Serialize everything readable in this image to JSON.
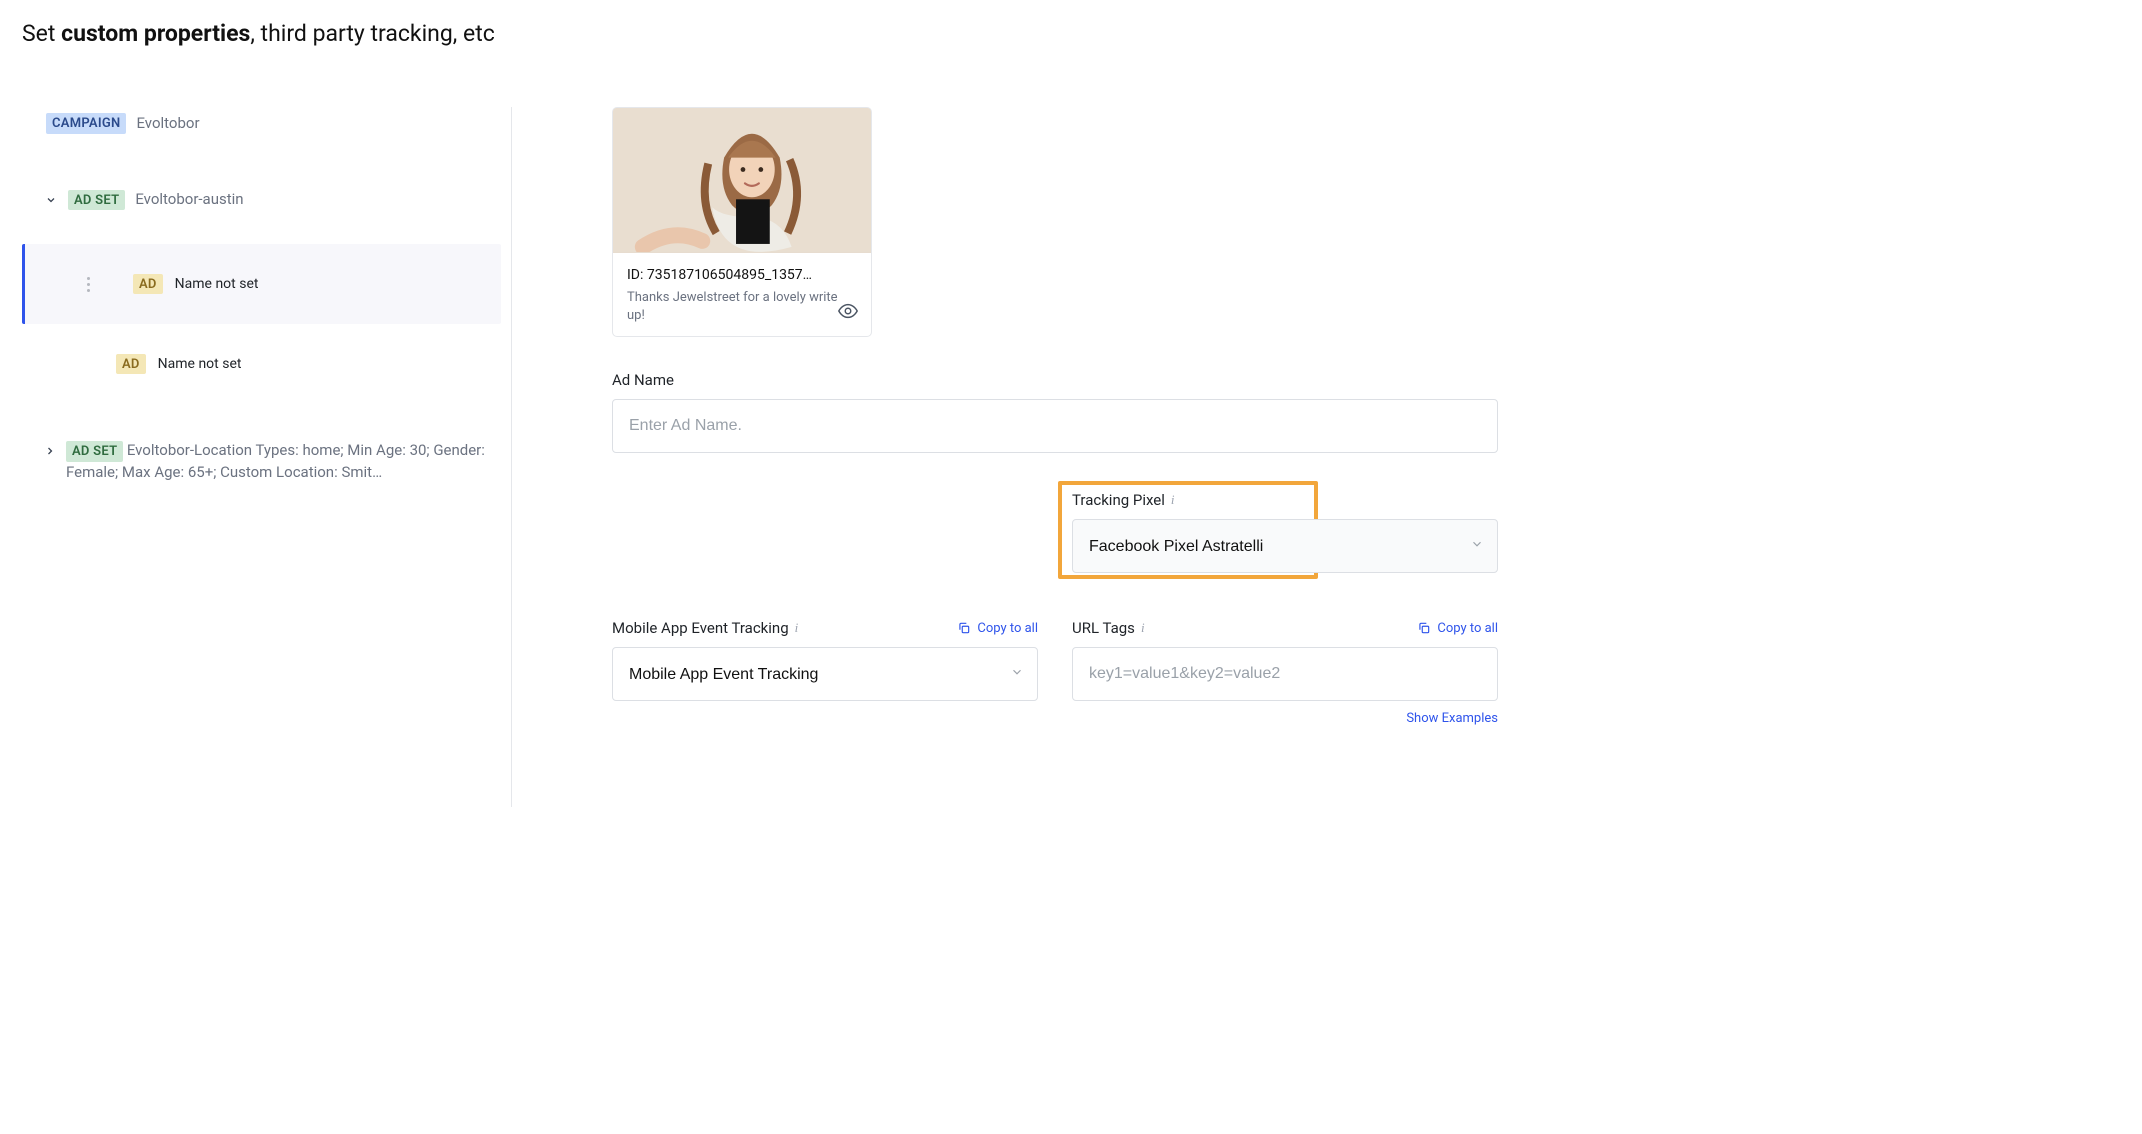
{
  "header": {
    "title_prefix": "Set ",
    "title_strong": "custom properties",
    "title_suffix": ", third party tracking, etc"
  },
  "sidebar": {
    "campaign_badge": "CAMPAIGN",
    "campaign_name": "Evoltobor",
    "adset_badge": "AD SET",
    "ad_badge": "AD",
    "adset1_name": "Evoltobor-austin",
    "ad1_name": "Name not set",
    "ad2_name": "Name not set",
    "adset2_name": "Evoltobor-Location Types: home; Min Age: 30; Gender: Female; Max Age: 65+; Custom Location: Smit…"
  },
  "creative": {
    "id_label": "ID: 735187106504895_1357…",
    "caption": "Thanks Jewelstreet for a lovely write up!"
  },
  "form": {
    "ad_name_label": "Ad Name",
    "ad_name_placeholder": "Enter Ad Name.",
    "tracking_pixel_label": "Tracking Pixel",
    "tracking_pixel_value": "Facebook Pixel Astratelli",
    "mobile_label": "Mobile App Event Tracking",
    "mobile_placeholder": "Mobile App Event Tracking",
    "url_tags_label": "URL Tags",
    "url_tags_placeholder": "key1=value1&key2=value2",
    "copy_to_all": "Copy to all",
    "show_examples": "Show Examples"
  }
}
